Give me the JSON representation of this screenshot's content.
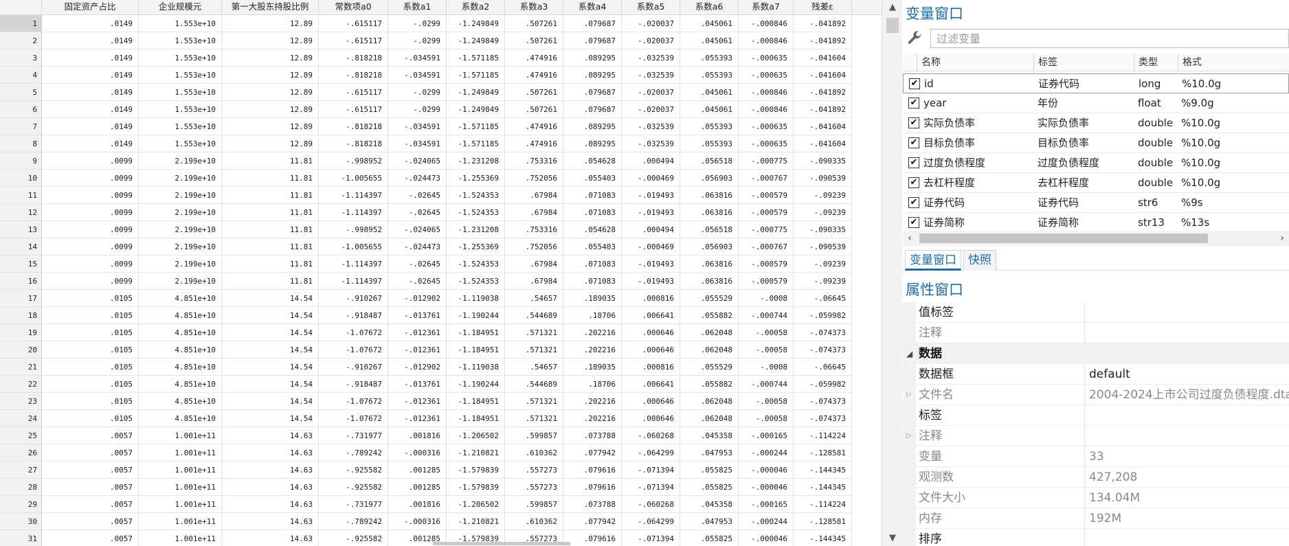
{
  "grid": {
    "columns": [
      "固定资产占比",
      "企业规模元",
      "第一大股东持股比例",
      "常数项a0",
      "系数a1",
      "系数a2",
      "系数a3",
      "系数a4",
      "系数a5",
      "系数a6",
      "系数a7",
      "残差ε"
    ],
    "rows": [
      {
        "n": "1",
        "c": [
          ".0149",
          "1.553e+10",
          "12.89",
          "-.615117",
          "-.0299",
          "-1.249849",
          ".507261",
          ".079687",
          "-.020037",
          ".045061",
          "-.000846",
          "-.041892"
        ]
      },
      {
        "n": "2",
        "c": [
          ".0149",
          "1.553e+10",
          "12.89",
          "-.615117",
          "-.0299",
          "-1.249849",
          ".507261",
          ".079687",
          "-.020037",
          ".045061",
          "-.000846",
          "-.041892"
        ]
      },
      {
        "n": "3",
        "c": [
          ".0149",
          "1.553e+10",
          "12.89",
          "-.818218",
          "-.034591",
          "-1.571185",
          ".474916",
          ".089295",
          "-.032539",
          ".055393",
          "-.000635",
          "-.041604"
        ]
      },
      {
        "n": "4",
        "c": [
          ".0149",
          "1.553e+10",
          "12.89",
          "-.818218",
          "-.034591",
          "-1.571185",
          ".474916",
          ".089295",
          "-.032539",
          ".055393",
          "-.000635",
          "-.041604"
        ]
      },
      {
        "n": "5",
        "c": [
          ".0149",
          "1.553e+10",
          "12.89",
          "-.615117",
          "-.0299",
          "-1.249849",
          ".507261",
          ".079687",
          "-.020037",
          ".045061",
          "-.000846",
          "-.041892"
        ]
      },
      {
        "n": "6",
        "c": [
          ".0149",
          "1.553e+10",
          "12.89",
          "-.615117",
          "-.0299",
          "-1.249849",
          ".507261",
          ".079687",
          "-.020037",
          ".045061",
          "-.000846",
          "-.041892"
        ]
      },
      {
        "n": "7",
        "c": [
          ".0149",
          "1.553e+10",
          "12.89",
          "-.818218",
          "-.034591",
          "-1.571185",
          ".474916",
          ".089295",
          "-.032539",
          ".055393",
          "-.000635",
          "-.041604"
        ]
      },
      {
        "n": "8",
        "c": [
          ".0149",
          "1.553e+10",
          "12.89",
          "-.818218",
          "-.034591",
          "-1.571185",
          ".474916",
          ".089295",
          "-.032539",
          ".055393",
          "-.000635",
          "-.041604"
        ]
      },
      {
        "n": "9",
        "c": [
          ".0099",
          "2.199e+10",
          "11.81",
          "-.998952",
          "-.024065",
          "-1.231208",
          ".753316",
          ".054628",
          ".000494",
          ".056518",
          "-.000775",
          "-.090335"
        ]
      },
      {
        "n": "10",
        "c": [
          ".0099",
          "2.199e+10",
          "11.81",
          "-1.005655",
          "-.024473",
          "-1.255369",
          ".752056",
          ".055403",
          "-.000469",
          ".056903",
          "-.000767",
          "-.090539"
        ]
      },
      {
        "n": "11",
        "c": [
          ".0099",
          "2.199e+10",
          "11.81",
          "-1.114397",
          "-.02645",
          "-1.524353",
          ".67984",
          ".071083",
          "-.019493",
          ".063816",
          "-.000579",
          "-.09239"
        ]
      },
      {
        "n": "12",
        "c": [
          ".0099",
          "2.199e+10",
          "11.81",
          "-1.114397",
          "-.02645",
          "-1.524353",
          ".67984",
          ".071083",
          "-.019493",
          ".063816",
          "-.000579",
          "-.09239"
        ]
      },
      {
        "n": "13",
        "c": [
          ".0099",
          "2.199e+10",
          "11.81",
          "-.998952",
          "-.024065",
          "-1.231208",
          ".753316",
          ".054628",
          ".000494",
          ".056518",
          "-.000775",
          "-.090335"
        ]
      },
      {
        "n": "14",
        "c": [
          ".0099",
          "2.199e+10",
          "11.81",
          "-1.005655",
          "-.024473",
          "-1.255369",
          ".752056",
          ".055403",
          "-.000469",
          ".056903",
          "-.000767",
          "-.090539"
        ]
      },
      {
        "n": "15",
        "c": [
          ".0099",
          "2.199e+10",
          "11.81",
          "-1.114397",
          "-.02645",
          "-1.524353",
          ".67984",
          ".071083",
          "-.019493",
          ".063816",
          "-.000579",
          "-.09239"
        ]
      },
      {
        "n": "16",
        "c": [
          ".0099",
          "2.199e+10",
          "11.81",
          "-1.114397",
          "-.02645",
          "-1.524353",
          ".67984",
          ".071083",
          "-.019493",
          ".063816",
          "-.000579",
          "-.09239"
        ]
      },
      {
        "n": "17",
        "c": [
          ".0105",
          "4.851e+10",
          "14.54",
          "-.910267",
          "-.012902",
          "-1.119038",
          ".54657",
          ".189035",
          ".000816",
          ".055529",
          "-.0008",
          "-.06645"
        ]
      },
      {
        "n": "18",
        "c": [
          ".0105",
          "4.851e+10",
          "14.54",
          "-.918487",
          "-.013761",
          "-1.190244",
          ".544689",
          ".18706",
          ".006641",
          ".055882",
          "-.000744",
          "-.059982"
        ]
      },
      {
        "n": "19",
        "c": [
          ".0105",
          "4.851e+10",
          "14.54",
          "-1.07672",
          "-.012361",
          "-1.184951",
          ".571321",
          ".202216",
          ".000646",
          ".062048",
          "-.00058",
          "-.074373"
        ]
      },
      {
        "n": "20",
        "c": [
          ".0105",
          "4.851e+10",
          "14.54",
          "-1.07672",
          "-.012361",
          "-1.184951",
          ".571321",
          ".202216",
          ".000646",
          ".062048",
          "-.00058",
          "-.074373"
        ]
      },
      {
        "n": "21",
        "c": [
          ".0105",
          "4.851e+10",
          "14.54",
          "-.910267",
          "-.012902",
          "-1.119038",
          ".54657",
          ".189035",
          ".000816",
          ".055529",
          "-.0008",
          "-.06645"
        ]
      },
      {
        "n": "22",
        "c": [
          ".0105",
          "4.851e+10",
          "14.54",
          "-.918487",
          "-.013761",
          "-1.190244",
          ".544689",
          ".18706",
          ".006641",
          ".055882",
          "-.000744",
          "-.059982"
        ]
      },
      {
        "n": "23",
        "c": [
          ".0105",
          "4.851e+10",
          "14.54",
          "-1.07672",
          "-.012361",
          "-1.184951",
          ".571321",
          ".202216",
          ".000646",
          ".062048",
          "-.00058",
          "-.074373"
        ]
      },
      {
        "n": "24",
        "c": [
          ".0105",
          "4.851e+10",
          "14.54",
          "-1.07672",
          "-.012361",
          "-1.184951",
          ".571321",
          ".202216",
          ".000646",
          ".062048",
          "-.00058",
          "-.074373"
        ]
      },
      {
        "n": "25",
        "c": [
          ".0057",
          "1.001e+11",
          "14.63",
          "-.731977",
          ".001816",
          "-1.206502",
          ".599857",
          ".073788",
          "-.060268",
          ".045358",
          "-.000165",
          "-.114224"
        ]
      },
      {
        "n": "26",
        "c": [
          ".0057",
          "1.001e+11",
          "14.63",
          "-.789242",
          "-.000316",
          "-1.210821",
          ".610362",
          ".077942",
          "-.064299",
          ".047953",
          "-.000244",
          "-.128581"
        ]
      },
      {
        "n": "27",
        "c": [
          ".0057",
          "1.001e+11",
          "14.63",
          "-.925582",
          ".001285",
          "-1.579839",
          ".557273",
          ".079616",
          "-.071394",
          ".055825",
          "-.000046",
          "-.144345"
        ]
      },
      {
        "n": "28",
        "c": [
          ".0057",
          "1.001e+11",
          "14.63",
          "-.925582",
          ".001285",
          "-1.579839",
          ".557273",
          ".079616",
          "-.071394",
          ".055825",
          "-.000046",
          "-.144345"
        ]
      },
      {
        "n": "29",
        "c": [
          ".0057",
          "1.001e+11",
          "14.63",
          "-.731977",
          ".001816",
          "-1.206502",
          ".599857",
          ".073788",
          "-.060268",
          ".045358",
          "-.000165",
          "-.114224"
        ]
      },
      {
        "n": "30",
        "c": [
          ".0057",
          "1.001e+11",
          "14.63",
          "-.789242",
          "-.000316",
          "-1.210821",
          ".610362",
          ".077942",
          "-.064299",
          ".047953",
          "-.000244",
          "-.128581"
        ]
      },
      {
        "n": "31",
        "c": [
          ".0057",
          "1.001e+11",
          "14.63",
          "-.925582",
          ".001285",
          "-1.579839",
          ".557273",
          ".079616",
          "-.071394",
          ".055825",
          "-.000046",
          "-.144345"
        ]
      }
    ]
  },
  "variables_panel": {
    "title": "变量窗口",
    "filter_placeholder": "过滤变量",
    "headers": [
      "名称",
      "标签",
      "类型",
      "格式"
    ],
    "items": [
      {
        "name": "id",
        "label": "证券代码",
        "type": "long",
        "format": "%10.0g",
        "checked": "✔"
      },
      {
        "name": "year",
        "label": "年份",
        "type": "float",
        "format": "%9.0g",
        "checked": "✔"
      },
      {
        "name": "实际负债率",
        "label": "实际负债率",
        "type": "double",
        "format": "%10.0g",
        "checked": "✔"
      },
      {
        "name": "目标负债率",
        "label": "目标负债率",
        "type": "double",
        "format": "%10.0g",
        "checked": "✔"
      },
      {
        "name": "过度负债程度",
        "label": "过度负债程度",
        "type": "double",
        "format": "%10.0g",
        "checked": "✔"
      },
      {
        "name": "去杠杆程度",
        "label": "去杠杆程度",
        "type": "double",
        "format": "%10.0g",
        "checked": "✔"
      },
      {
        "name": "证券代码",
        "label": "证券代码",
        "type": "str6",
        "format": "%9s",
        "checked": "✔"
      },
      {
        "name": "证券简称",
        "label": "证券简称",
        "type": "str13",
        "format": "%13s",
        "checked": "✔"
      }
    ],
    "scroll_left": "‹",
    "scroll_right": "›"
  },
  "tabs": [
    {
      "label": "变量窗口"
    },
    {
      "label": "快照"
    }
  ],
  "properties_panel": {
    "title": "属性窗口",
    "rows": [
      {
        "label": "值标签",
        "value": "",
        "kind": "item"
      },
      {
        "label": "注释",
        "value": "",
        "kind": "item-grey"
      },
      {
        "label": "数据",
        "value": "",
        "kind": "group"
      },
      {
        "label": "数据框",
        "value": "default",
        "kind": "item"
      },
      {
        "label": "文件名",
        "value": "2004-2024上市公司过度负债程度.dta",
        "kind": "item-grey-exp"
      },
      {
        "label": "标签",
        "value": "",
        "kind": "item"
      },
      {
        "label": "注释",
        "value": "",
        "kind": "item-grey-exp"
      },
      {
        "label": "变量",
        "value": "33",
        "kind": "item-grey"
      },
      {
        "label": "观测数",
        "value": "427,208",
        "kind": "item-grey"
      },
      {
        "label": "文件大小",
        "value": "134.04M",
        "kind": "item-grey"
      },
      {
        "label": "内存",
        "value": "192M",
        "kind": "item-grey"
      },
      {
        "label": "排序",
        "value": "",
        "kind": "item"
      }
    ]
  },
  "colors": {
    "accent": "#1f6aa5",
    "row_header_bg": "#f1f1f1",
    "selected_row_header": "#d4d4d4"
  },
  "icons": {
    "filter": "wrench-icon",
    "scroll_up": "▲",
    "scroll_down": "▼",
    "group_expander": "◢",
    "item_expander": "▷"
  }
}
